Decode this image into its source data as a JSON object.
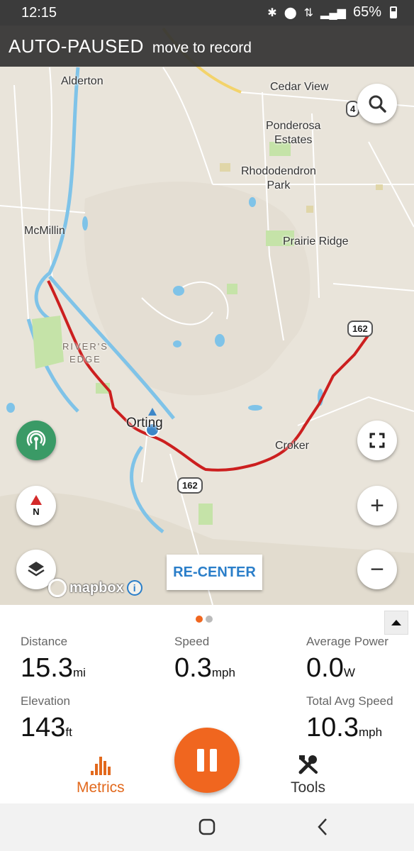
{
  "status_bar": {
    "time": "12:15",
    "battery": "65%",
    "icons": [
      "bluetooth-icon",
      "location-icon",
      "data-saver-icon",
      "signal-icon",
      "battery-icon"
    ]
  },
  "banner": {
    "status": "AUTO-PAUSED",
    "hint": "move to record"
  },
  "map": {
    "labels": {
      "alderton": "Alderton",
      "cedar_view": "Cedar View",
      "ponderosa": "Ponderosa\nEstates",
      "rhododendron": "Rhododendron\nPark",
      "mcmillin": "McMillin",
      "prairie_ridge": "Prairie Ridge",
      "rivers_edge": "RIVER'S\nEDGE",
      "orting": "Orting",
      "croker": "Croker"
    },
    "shields": {
      "s1": "162",
      "s2": "162",
      "s3": "4"
    },
    "recenter_label": "RE-CENTER",
    "compass_label": "N",
    "attribution": "mapbox",
    "colors": {
      "route": "#cc1f1f",
      "water": "#7fc3e8",
      "park": "#c5e3a8",
      "land": "#e9e4da"
    }
  },
  "metrics_panel": {
    "page_dots": {
      "active": "#f0661f",
      "inactive": "#bbbbbb"
    },
    "metrics": [
      {
        "name": "Distance",
        "value": "15.3",
        "unit": "mi"
      },
      {
        "name": "Speed",
        "value": "0.3",
        "unit": "mph"
      },
      {
        "name": "Average Power",
        "value": "0.0",
        "unit": "W"
      },
      {
        "name": "Elevation",
        "value": "143",
        "unit": "ft"
      },
      {
        "name": "Total Avg Speed",
        "value": "10.3",
        "unit": "mph"
      }
    ]
  },
  "bottom_nav": {
    "metrics_label": "Metrics",
    "tools_label": "Tools",
    "accent": "#e2691d"
  }
}
